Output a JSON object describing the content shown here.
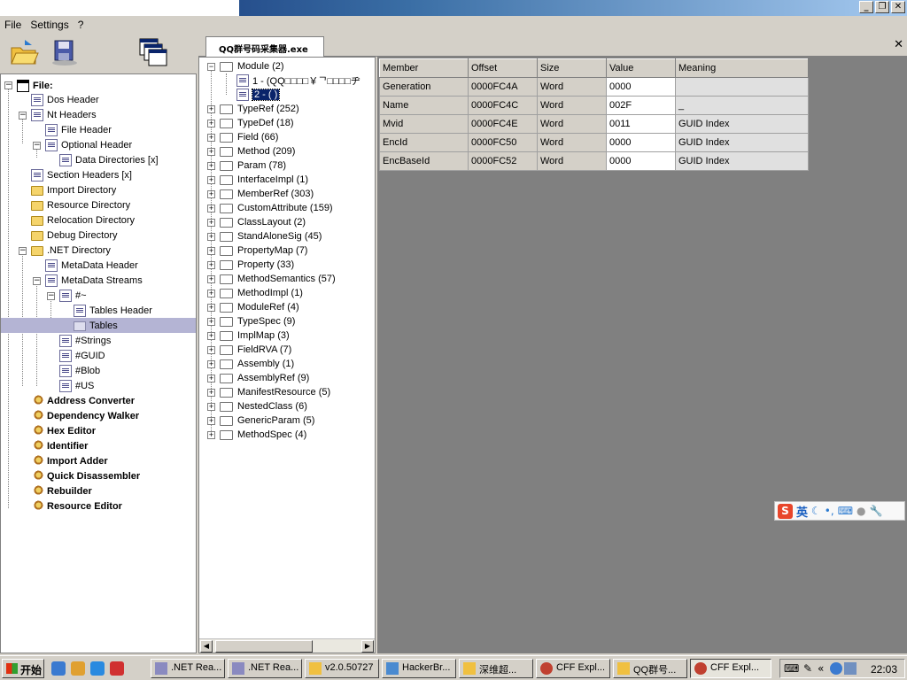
{
  "menu": {
    "file": "File",
    "settings": "Settings",
    "help": "?"
  },
  "window_controls": {
    "minimize": "_",
    "restore": "❐",
    "close": "✕"
  },
  "tab": {
    "label": "QQ群号码采集器.exe",
    "close": "✕"
  },
  "left_tree": {
    "root": "File: ",
    "items": [
      {
        "label": "Dos Header"
      },
      {
        "label": "Nt Headers"
      },
      {
        "label": "File Header"
      },
      {
        "label": "Optional Header"
      },
      {
        "label": "Data Directories [x]"
      },
      {
        "label": "Section Headers [x]"
      },
      {
        "label": "Import Directory"
      },
      {
        "label": "Resource Directory"
      },
      {
        "label": "Relocation Directory"
      },
      {
        "label": "Debug Directory"
      },
      {
        "label": ".NET Directory"
      },
      {
        "label": "MetaData Header"
      },
      {
        "label": "MetaData Streams"
      },
      {
        "label": "#~"
      },
      {
        "label": "Tables Header"
      },
      {
        "label": "Tables"
      },
      {
        "label": "#Strings"
      },
      {
        "label": "#GUID"
      },
      {
        "label": "#Blob"
      },
      {
        "label": "#US"
      }
    ],
    "tools": [
      "Address Converter",
      "Dependency Walker",
      "Hex Editor",
      "Identifier",
      "Import Adder",
      "Quick Disassembler",
      "Rebuilder",
      "Resource Editor"
    ]
  },
  "mid_tree": {
    "expanded": "Module (2)",
    "children": [
      "1 - (QQ□□□□￥ᄀ□□□□ヂ",
      "2 - ( )"
    ],
    "tables": [
      "TypeRef (252)",
      "TypeDef (18)",
      "Field (66)",
      "Method (209)",
      "Param (78)",
      "InterfaceImpl (1)",
      "MemberRef (303)",
      "CustomAttribute (159)",
      "ClassLayout (2)",
      "StandAloneSig (45)",
      "PropertyMap (7)",
      "Property (33)",
      "MethodSemantics (57)",
      "MethodImpl (1)",
      "ModuleRef (4)",
      "TypeSpec (9)",
      "ImplMap (3)",
      "FieldRVA (7)",
      "Assembly (1)",
      "AssemblyRef (9)",
      "ManifestResource (5)",
      "NestedClass (6)",
      "GenericParam (5)",
      "MethodSpec (4)"
    ]
  },
  "grid": {
    "columns": [
      "Member",
      "Offset",
      "Size",
      "Value",
      "Meaning"
    ],
    "rows": [
      [
        "Generation",
        "0000FC4A",
        "Word",
        "0000",
        ""
      ],
      [
        "Name",
        "0000FC4C",
        "Word",
        "002F",
        "_"
      ],
      [
        "Mvid",
        "0000FC4E",
        "Word",
        "0011",
        "GUID Index"
      ],
      [
        "EncId",
        "0000FC50",
        "Word",
        "0000",
        "GUID Index"
      ],
      [
        "EncBaseId",
        "0000FC52",
        "Word",
        "0000",
        "GUID Index"
      ]
    ]
  },
  "ime": {
    "logo": "S",
    "lang": "英"
  },
  "taskbar": {
    "start": "开始",
    "tasks": [
      ".NET Rea...",
      ".NET Rea...",
      "v2.0.50727",
      "HackerBr...",
      "深维超...",
      "CFF Expl...",
      "QQ群号...",
      "CFF Expl..."
    ],
    "clock": "22:03"
  }
}
